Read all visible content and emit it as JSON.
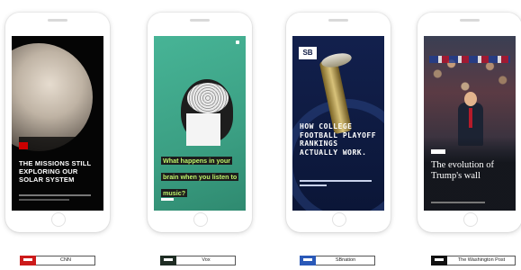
{
  "stories": [
    {
      "headline": "THE MISSIONS STILL EXPLORING OUR SOLAR SYSTEM",
      "accent": "#cc0000"
    },
    {
      "headline": "What happens in your brain when you listen to music?",
      "accent": "#bdf36b"
    },
    {
      "brand": "SB",
      "headline": "HOW COLLEGE FOOTBALL PLAYOFF RANKINGS ACTUALLY WORK.",
      "accent": "#0e1a44"
    },
    {
      "headline": "The evolution of Trump's wall",
      "accent": "#20232c"
    }
  ],
  "publishers": [
    {
      "name": "CNN",
      "color": "#cc1b1b"
    },
    {
      "name": "Vox",
      "color": "#1f2d24"
    },
    {
      "name": "SBnation",
      "color": "#2a59b8"
    },
    {
      "name": "The Washington Post",
      "color": "#111111"
    }
  ]
}
